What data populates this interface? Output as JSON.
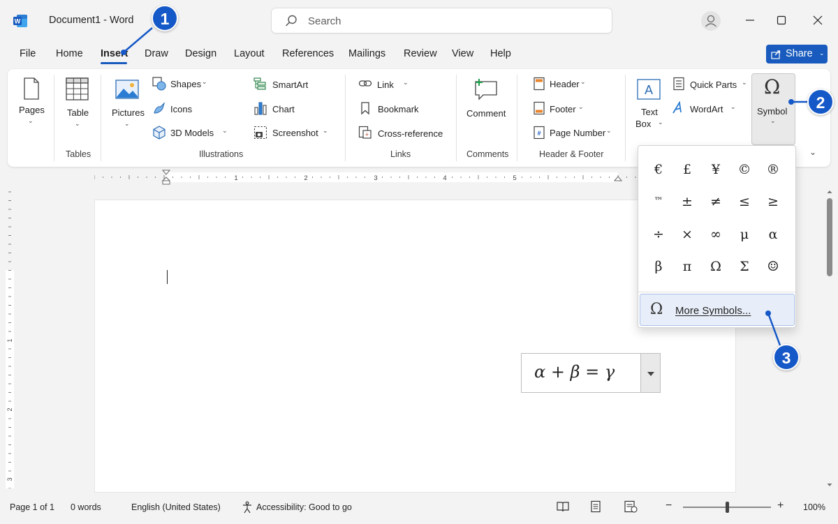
{
  "window": {
    "title": "Document1  -  Word",
    "search_placeholder": "Search"
  },
  "menu": {
    "tabs": [
      "File",
      "Home",
      "Insert",
      "Draw",
      "Design",
      "Layout",
      "References",
      "Mailings",
      "Review",
      "View",
      "Help"
    ],
    "active_tab": "Insert",
    "share_label": "Share"
  },
  "ribbon": {
    "pages": {
      "label": "Pages"
    },
    "tables": {
      "table_label": "Table",
      "group_label": "Tables"
    },
    "illustrations": {
      "pictures_label": "Pictures",
      "shapes_label": "Shapes",
      "icons_label": "Icons",
      "models_label": "3D Models",
      "smartart_label": "SmartArt",
      "chart_label": "Chart",
      "screenshot_label": "Screenshot",
      "group_label": "Illustrations"
    },
    "links": {
      "link_label": "Link",
      "bookmark_label": "Bookmark",
      "crossref_label": "Cross-reference",
      "group_label": "Links"
    },
    "comments": {
      "comment_label": "Comment",
      "group_label": "Comments"
    },
    "header_footer": {
      "header_label": "Header",
      "footer_label": "Footer",
      "page_number_label": "Page Number",
      "group_label": "Header & Footer"
    },
    "text": {
      "textbox_label_1": "Text",
      "textbox_label_2": "Box",
      "quickparts_label": "Quick Parts",
      "wordart_label": "WordArt"
    },
    "symbol": {
      "label": "Symbol"
    }
  },
  "ruler": {
    "h_numbers": [
      "1",
      "2",
      "3",
      "4",
      "5"
    ],
    "v_numbers": [
      "1",
      "2",
      "3"
    ]
  },
  "document": {
    "equation": "α + β = γ"
  },
  "symbol_menu": {
    "symbols": [
      "€",
      "£",
      "¥",
      "©",
      "®",
      "™",
      "±",
      "≠",
      "≤",
      "≥",
      "÷",
      "×",
      "∞",
      "μ",
      "α",
      "β",
      "π",
      "Ω",
      "Σ",
      "☺"
    ],
    "more_label": "More Symbols..."
  },
  "callouts": [
    "1",
    "2",
    "3"
  ],
  "status": {
    "page": "Page 1 of 1",
    "words": "0 words",
    "language": "English (United States)",
    "accessibility": "Accessibility: Good to go",
    "zoom": "100%",
    "zoom_level": 1.0
  }
}
